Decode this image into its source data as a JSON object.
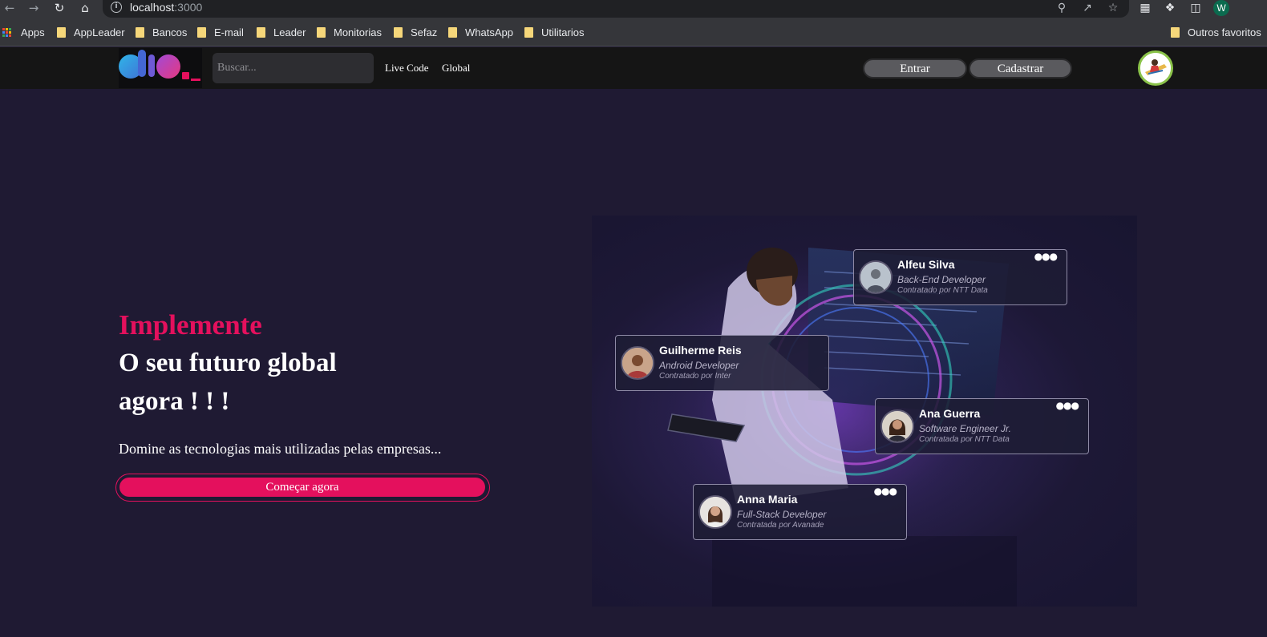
{
  "browser": {
    "url_host": "localhost",
    "url_port": ":3000",
    "profile_initial": "W",
    "bookmarks": [
      "Apps",
      "AppLeader",
      "Bancos",
      "E-mail",
      "Leader",
      "Monitorias",
      "Sefaz",
      "WhatsApp",
      "Utilitarios"
    ],
    "other_bookmarks": "Outros favoritos"
  },
  "header": {
    "search_placeholder": "Buscar...",
    "menu": [
      "Live Code",
      "Global"
    ],
    "login_label": "Entrar",
    "signup_label": "Cadastrar"
  },
  "hero": {
    "accent": "Implemente",
    "line1": "O seu futuro global",
    "line2": "agora ! ! !",
    "subtitle": "Domine as tecnologias mais utilizadas pelas empresas...",
    "cta": "Começar agora"
  },
  "profile_cards": [
    {
      "name": "Alfeu Silva",
      "role": "Back-End Developer",
      "hired": "Contratado por NTT Data"
    },
    {
      "name": "Guilherme Reis",
      "role": "Android Developer",
      "hired": "Contratado por Inter"
    },
    {
      "name": "Ana Guerra",
      "role": "Software Engineer Jr.",
      "hired": "Contratada por NTT Data"
    },
    {
      "name": "Anna Maria",
      "role": "Full-Stack Developer",
      "hired": "Contratada por Avanade"
    }
  ],
  "colors": {
    "accent": "#e4105d",
    "page_bg": "#1f1a33",
    "header_bg": "#151515",
    "avatar_ring": "#8bc34a"
  }
}
